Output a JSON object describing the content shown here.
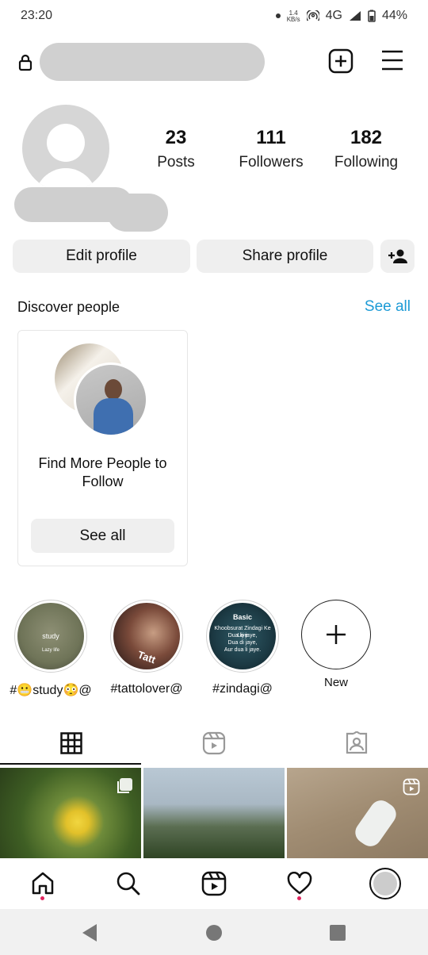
{
  "status_bar": {
    "time": "23:20",
    "net_speed_value": "1.4",
    "net_speed_unit": "KB/s",
    "network": "4G",
    "battery": "44%"
  },
  "top_bar": {
    "icons": [
      "lock-icon",
      "create-icon",
      "menu-icon"
    ]
  },
  "profile": {
    "stats": [
      {
        "value": "23",
        "label": "Posts"
      },
      {
        "value": "111",
        "label": "Followers"
      },
      {
        "value": "182",
        "label": "Following"
      }
    ],
    "edit_label": "Edit profile",
    "share_label": "Share profile"
  },
  "discover": {
    "title": "Discover people",
    "see_all": "See all",
    "card_title": "Find More People to Follow",
    "card_button": "See all"
  },
  "highlights": [
    {
      "label": "#😬study😳@"
    },
    {
      "label": "#tattolover@"
    },
    {
      "label": "#zindagi@"
    },
    {
      "label": "New"
    }
  ],
  "highlight_text": {
    "study": "study",
    "lazy": "Lazy life",
    "tatt": "Tatt",
    "basic": "Basic",
    "zindagi_lines": [
      "Khoobsurat Zindagi Ke Liye",
      "Dua ki jaye,",
      "Dua di jaye,",
      "Aur dua li jaye."
    ]
  },
  "tabs": [
    "grid-icon",
    "reels-icon",
    "tagged-icon"
  ],
  "colors": {
    "accent_link": "#1d9bd6",
    "button_bg": "#efefef",
    "notification_dot": "#e0245e"
  }
}
